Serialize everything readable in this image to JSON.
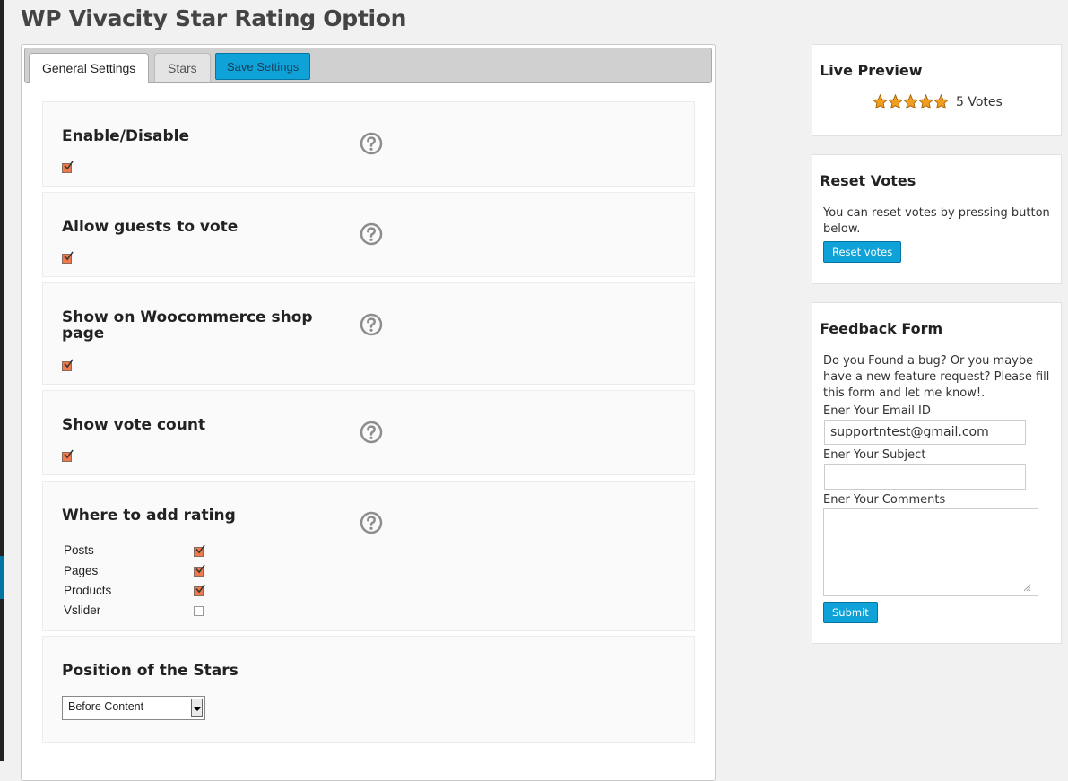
{
  "page": {
    "title": "WP Vivacity Star Rating Option"
  },
  "tabs": {
    "general": "General Settings",
    "stars": "Stars",
    "save": "Save Settings"
  },
  "settings": {
    "enable": {
      "title": "Enable/Disable",
      "checked": true
    },
    "guests": {
      "title": "Allow guests to vote",
      "checked": true
    },
    "shop": {
      "title": "Show on Woocommerce shop page",
      "checked": true
    },
    "count": {
      "title": "Show vote count",
      "checked": true
    },
    "where": {
      "title": "Where to add rating",
      "items": [
        {
          "label": "Posts",
          "checked": true
        },
        {
          "label": "Pages",
          "checked": true
        },
        {
          "label": "Products",
          "checked": true
        },
        {
          "label": "Vslider",
          "checked": false
        }
      ]
    },
    "position": {
      "title": "Position of the Stars",
      "selected": "Before Content"
    }
  },
  "preview": {
    "title": "Live Preview",
    "stars": 5,
    "votes_text": "5 Votes"
  },
  "reset": {
    "title": "Reset Votes",
    "text": "You can reset votes by pressing button below.",
    "button": "Reset votes"
  },
  "feedback": {
    "title": "Feedback Form",
    "text": "Do you Found a bug? Or you maybe have a new feature request? Please fill this form and let me know!.",
    "email_label": "Ener Your Email ID",
    "email_value": "supportntest@gmail.com",
    "subject_label": "Ener Your Subject",
    "subject_value": "",
    "comments_label": "Ener Your Comments",
    "submit": "Submit"
  },
  "colors": {
    "accent": "#0ea2d8",
    "checkbox": "#ee7a4c",
    "star": "#f0a020"
  },
  "icons": {
    "help": "question-circle-icon",
    "star": "star-icon",
    "check": "checkmark-icon"
  }
}
